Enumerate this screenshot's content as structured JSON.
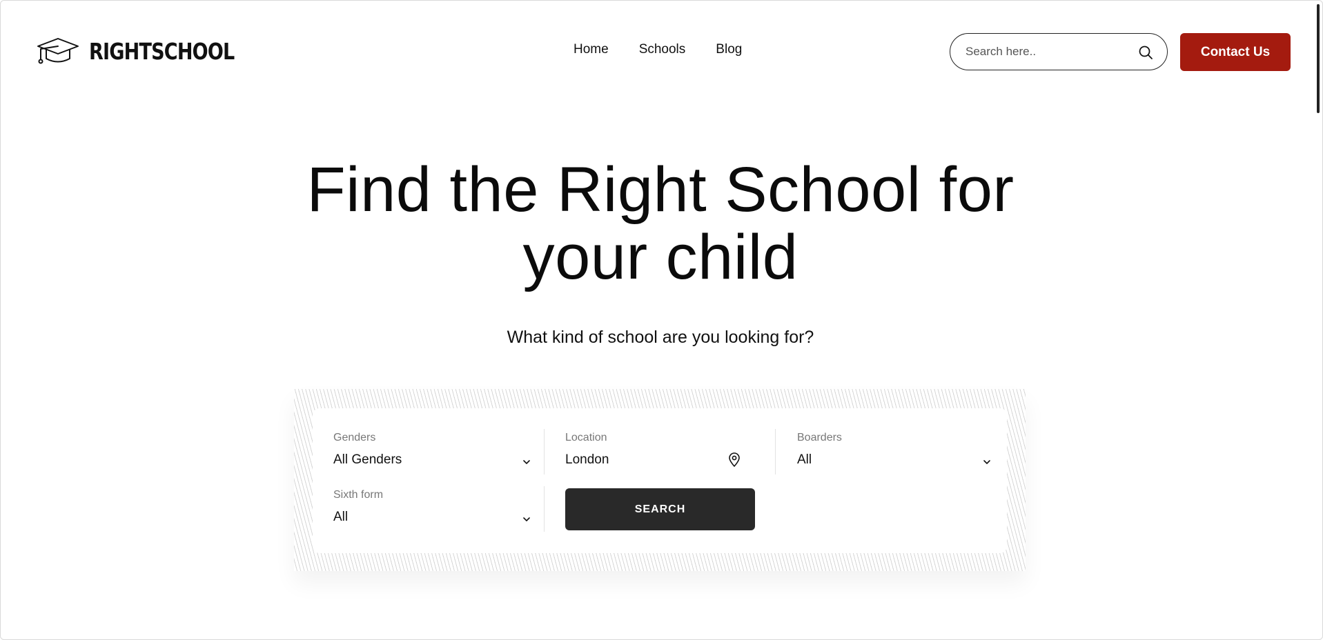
{
  "brand": {
    "logo_icon": "graduation-cap-icon",
    "name": "RIGHTSCHOOL"
  },
  "nav": {
    "items": [
      "Home",
      "Schools",
      "Blog"
    ]
  },
  "header_search": {
    "placeholder": "Search here..",
    "icon": "search-icon"
  },
  "contact_button": "Contact Us",
  "hero": {
    "title_line1": "Find the Right School for",
    "title_line2": "your child",
    "subtitle": "What kind of school are you looking for?"
  },
  "search_form": {
    "genders": {
      "label": "Genders",
      "value": "All Genders"
    },
    "location": {
      "label": "Location",
      "value": "London",
      "icon": "map-pin-icon"
    },
    "boarders": {
      "label": "Boarders",
      "value": "All"
    },
    "sixth_form": {
      "label": "Sixth form",
      "value": "All"
    },
    "submit": "SEARCH"
  },
  "colors": {
    "accent": "#a41b0f",
    "button_dark": "#292929"
  }
}
